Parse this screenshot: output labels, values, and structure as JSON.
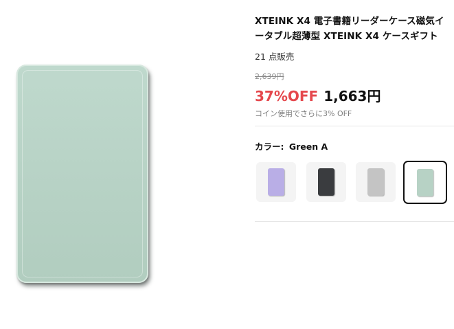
{
  "product": {
    "title": "XTEINK X4 電子書籍リーダーケース磁気イ\nータブル超薄型 XTEINK X4 ケースギフト",
    "sold_count": "21 点販売",
    "original_price": "2,639円",
    "discount": "37%OFF",
    "price": "1,663円",
    "coin_note": "コイン使用でさらに3% OFF"
  },
  "color_selector": {
    "label": "カラー",
    "separator": ":",
    "selected_value": "Green A",
    "options": [
      {
        "name": "purple",
        "color": "#b9aee6",
        "selected": false
      },
      {
        "name": "black",
        "color": "#3a3c3f",
        "selected": false
      },
      {
        "name": "gray",
        "color": "#c4c4c4",
        "selected": false
      },
      {
        "name": "green",
        "color": "#b7d2c5",
        "selected": true
      }
    ]
  },
  "colors": {
    "accent_discount": "#e5484d",
    "case_color": "#b7d2c5"
  }
}
